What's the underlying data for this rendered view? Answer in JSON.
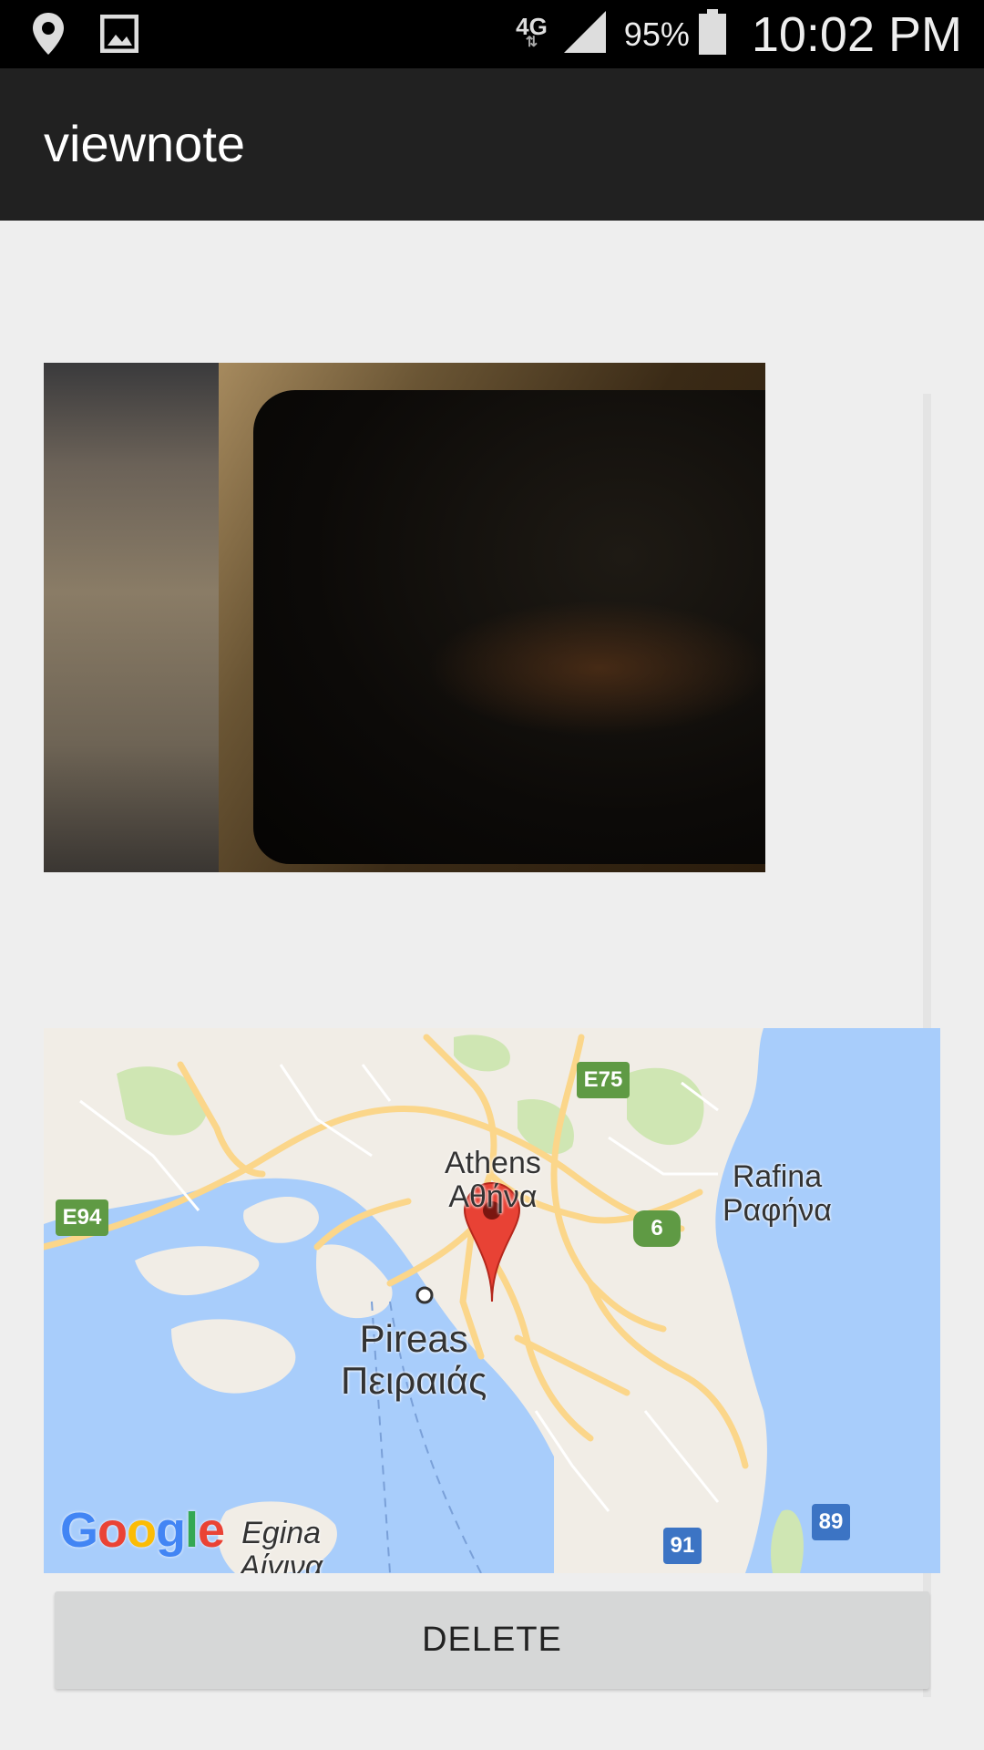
{
  "status_bar": {
    "network": "4G",
    "battery_percent": "95%",
    "time": "10:02 PM",
    "icons": [
      "location-icon",
      "image-icon",
      "signal-icon",
      "battery-icon"
    ]
  },
  "app_bar": {
    "title": "viewnote"
  },
  "map": {
    "labels": {
      "athens_en": "Athens",
      "athens_gr": "Αθήνα",
      "rafina_en": "Rafina",
      "rafina_gr": "Ραφήνα",
      "pireas_en": "Pireas",
      "pireas_gr": "Πειραιάς",
      "egina_en": "Egina",
      "egina_gr": "Αίγινα"
    },
    "shields": {
      "e75": "E75",
      "e94": "E94",
      "r6": "6",
      "r91": "91",
      "r89": "89"
    },
    "attribution": [
      "G",
      "o",
      "o",
      "g",
      "l",
      "e"
    ],
    "colors": {
      "water": "#a8cdfb",
      "land": "#f1ede6",
      "road": "#fbd68a",
      "park": "#cfe6b3",
      "pin": "#e84235"
    }
  },
  "actions": {
    "delete_label": "DELETE"
  }
}
